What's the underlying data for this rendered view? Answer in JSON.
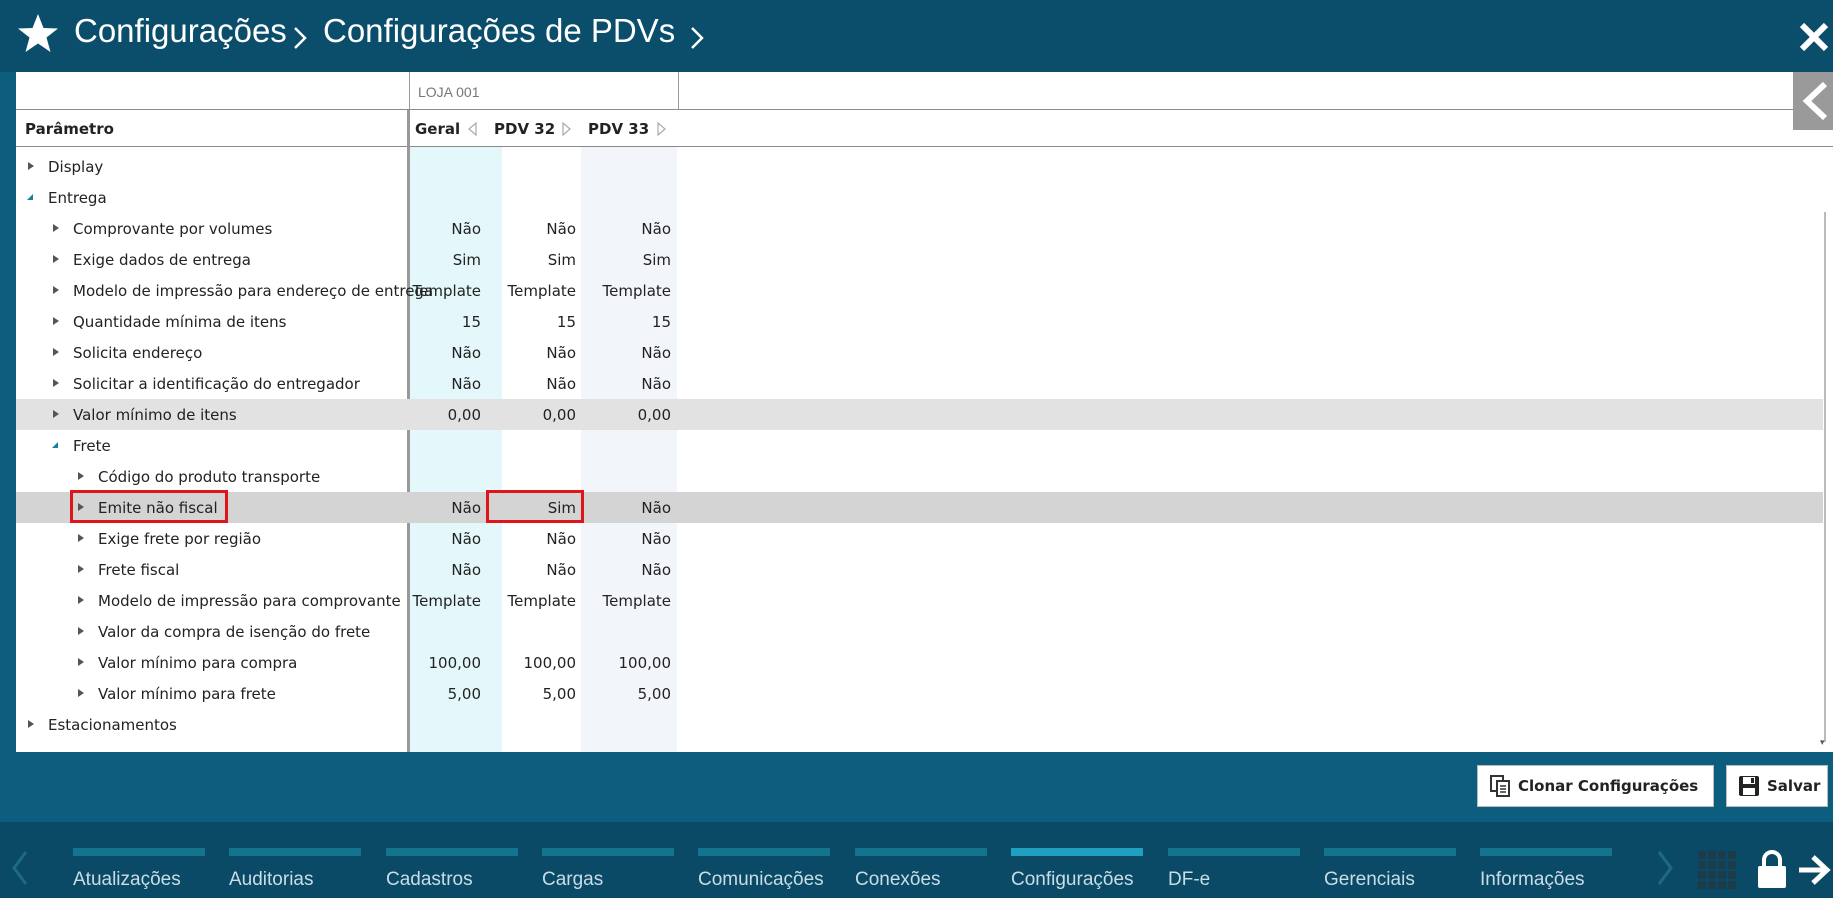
{
  "header": {
    "breadcrumb": [
      "Configurações",
      "Configurações de PDVs"
    ]
  },
  "table": {
    "store": "LOJA 001",
    "param_header": "Parâmetro",
    "columns": [
      "Geral",
      "PDV 32",
      "PDV 33"
    ],
    "rows": [
      {
        "label": "Display",
        "level": 0,
        "state": "collapsed",
        "values": [
          "",
          "",
          ""
        ]
      },
      {
        "label": "Entrega",
        "level": 0,
        "state": "expanded",
        "values": [
          "",
          "",
          ""
        ]
      },
      {
        "label": "Comprovante por volumes",
        "level": 1,
        "state": "collapsed",
        "values": [
          "Não",
          "Não",
          "Não"
        ]
      },
      {
        "label": "Exige dados de entrega",
        "level": 1,
        "state": "collapsed",
        "values": [
          "Sim",
          "Sim",
          "Sim"
        ]
      },
      {
        "label": "Modelo de impressão para endereço de entrega",
        "level": 1,
        "state": "collapsed",
        "values": [
          "Template",
          "Template",
          "Template"
        ]
      },
      {
        "label": "Quantidade mínima de itens",
        "level": 1,
        "state": "collapsed",
        "values": [
          "15",
          "15",
          "15"
        ]
      },
      {
        "label": "Solicita endereço",
        "level": 1,
        "state": "collapsed",
        "values": [
          "Não",
          "Não",
          "Não"
        ]
      },
      {
        "label": "Solicitar a identificação do entregador",
        "level": 1,
        "state": "collapsed",
        "values": [
          "Não",
          "Não",
          "Não"
        ]
      },
      {
        "label": "Valor mínimo de itens",
        "level": 1,
        "state": "collapsed",
        "values": [
          "0,00",
          "0,00",
          "0,00"
        ]
      },
      {
        "label": "Frete",
        "level": 1,
        "state": "expanded",
        "values": [
          "",
          "",
          ""
        ]
      },
      {
        "label": "Código do produto transporte",
        "level": 2,
        "state": "collapsed",
        "values": [
          "",
          "",
          ""
        ]
      },
      {
        "label": "Emite não fiscal",
        "level": 2,
        "state": "collapsed",
        "values": [
          "Não",
          "Sim",
          "Não"
        ]
      },
      {
        "label": "Exige frete por região",
        "level": 2,
        "state": "collapsed",
        "values": [
          "Não",
          "Não",
          "Não"
        ]
      },
      {
        "label": "Frete fiscal",
        "level": 2,
        "state": "collapsed",
        "values": [
          "Não",
          "Não",
          "Não"
        ]
      },
      {
        "label": "Modelo de impressão para comprovante",
        "level": 2,
        "state": "collapsed",
        "values": [
          "Template",
          "Template",
          "Template"
        ]
      },
      {
        "label": "Valor da compra de isenção do frete",
        "level": 2,
        "state": "collapsed",
        "values": [
          "",
          "",
          ""
        ]
      },
      {
        "label": "Valor mínimo para compra",
        "level": 2,
        "state": "collapsed",
        "values": [
          "100,00",
          "100,00",
          "100,00"
        ]
      },
      {
        "label": "Valor mínimo para frete",
        "level": 2,
        "state": "collapsed",
        "values": [
          "5,00",
          "5,00",
          "5,00"
        ]
      },
      {
        "label": "Estacionamentos",
        "level": 0,
        "state": "collapsed",
        "values": [
          "",
          "",
          ""
        ]
      }
    ]
  },
  "actions": {
    "clone_label": "Clonar Configurações",
    "save_label": "Salvar"
  },
  "nav": {
    "items": [
      "Atualizações",
      "Auditorias",
      "Cadastros",
      "Cargas",
      "Comunicações",
      "Conexões",
      "Configurações",
      "DF-e",
      "Gerenciais",
      "Informações"
    ],
    "active": "Configurações"
  },
  "colors": {
    "header_bg": "#0b4e6c",
    "body_bg": "#0d5d7e",
    "highlight_red": "#e0141c",
    "col_geral_bg": "#e4f8fb",
    "col_pdv33_bg": "#f2f6fb"
  },
  "icons": [
    "star-icon",
    "chevron-right-icon",
    "close-icon",
    "clone-icon",
    "save-icon",
    "grid-icon",
    "lock-icon",
    "exit-icon"
  ]
}
